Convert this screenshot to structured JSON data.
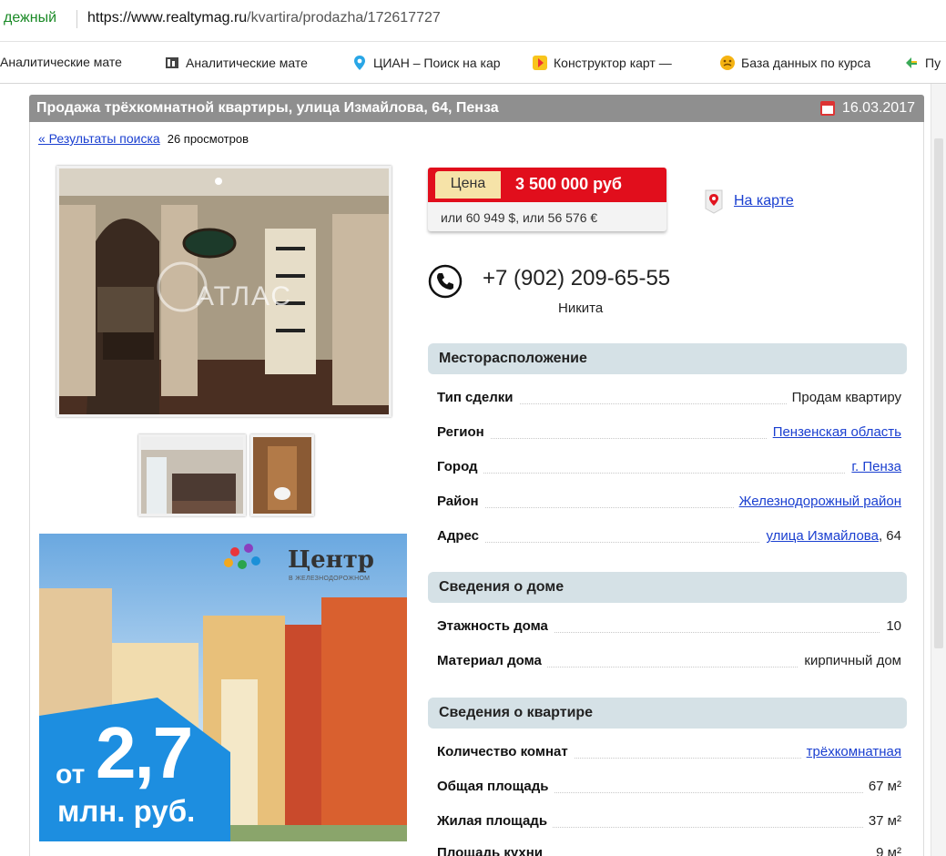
{
  "browser": {
    "secure_label": "дежный",
    "url_domain": "https://www.realtymag.ru",
    "url_path": "/kvartira/prodazha/172617727"
  },
  "bookmarks": [
    {
      "label": "Аналитические мате",
      "icon": "document-icon"
    },
    {
      "label": "Аналитические мате",
      "icon": "chart-icon"
    },
    {
      "label": "ЦИАН – Поиск на кар",
      "icon": "location-pin-icon"
    },
    {
      "label": "Конструктор карт —",
      "icon": "map-constructor-icon"
    },
    {
      "label": "База данных по курса",
      "icon": "smiley-icon"
    },
    {
      "label": "Пу",
      "icon": "bookmark-icon"
    }
  ],
  "listing": {
    "title": "Продажа трёхкомнатной квартиры, улица Измайлова, 64, Пенза",
    "date": "16.03.2017",
    "back_link": "« Результаты поиска",
    "views": "26 просмотров"
  },
  "price": {
    "label": "Цена",
    "value": "3 500 000 руб",
    "alt": "или 60 949 $, или 56 576 €"
  },
  "map_link": "На карте",
  "contact": {
    "phone": "+7 (902) 209-65-55",
    "name": "Никита"
  },
  "sections": {
    "location": {
      "title": "Месторасположение",
      "rows": [
        {
          "key": "Тип сделки",
          "value": "Продам квартиру"
        },
        {
          "key": "Регион",
          "value": "Пензенская область"
        },
        {
          "key": "Город",
          "value": "г. Пенза"
        },
        {
          "key": "Район",
          "value": "Железнодорожный район"
        },
        {
          "key": "Адрес",
          "value_link": "улица Измайлова",
          "value_suffix": ", 64"
        }
      ]
    },
    "house": {
      "title": "Сведения о доме",
      "rows": [
        {
          "key": "Этажность дома",
          "value": "10"
        },
        {
          "key": "Материал дома",
          "value": "кирпичный дом"
        }
      ]
    },
    "apartment": {
      "title": "Сведения о квартире",
      "rows": [
        {
          "key": "Количество комнат",
          "value": "трёхкомнатная"
        },
        {
          "key": "Общая площадь",
          "value": "67 м²"
        },
        {
          "key": "Жилая площадь",
          "value": "37 м²"
        },
        {
          "key": "Площадь кухни",
          "value": "9 м²"
        }
      ]
    }
  },
  "photo_watermark": "АТЛАС",
  "ad": {
    "brand": "Центр",
    "subtitle": "В ЖЕЛЕЗНОДОРОЖНОМ",
    "from": "от",
    "number": "2,7",
    "unit": "млн. руб."
  },
  "colors": {
    "price_red": "#e10e1c",
    "link_blue": "#1a3fd0",
    "section_bg": "#d5e1e6",
    "title_bar": "#8f8f8f",
    "ad_badge_blue": "#1d8ee0"
  }
}
